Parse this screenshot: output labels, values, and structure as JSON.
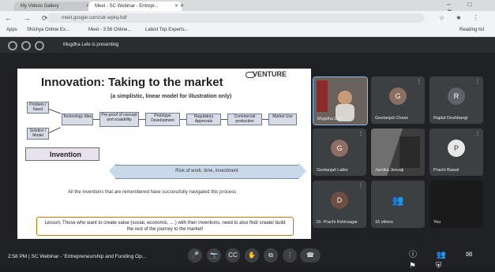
{
  "browser": {
    "tabs": [
      {
        "label": "My Videos Gallery"
      },
      {
        "label": "Meet - SC Webinar - Entrepr..."
      }
    ],
    "new_tab": "+",
    "window_controls": "– □ ✕",
    "nav": "← → ⟳",
    "url": "meet.google.com/sdr-wpkq-hdf",
    "tool_icons": "☆ ★ ⋮",
    "bookmarks": [
      {
        "label": "Apps"
      },
      {
        "label": "Shishya Online Ex..."
      },
      {
        "label": "Meet - 3:56 Online..."
      },
      {
        "label": "Latest Top Experts..."
      },
      {
        "label": "Reading list"
      }
    ]
  },
  "meet": {
    "presenting_text": "Mugdha Lele is presenting",
    "slide": {
      "title": "Innovation: Taking to the market",
      "brand": "VENTURE",
      "subtitle": "(a simplistic, linear model for illustration only)",
      "flow_left": [
        "Problem / Need",
        "Solution / Model"
      ],
      "flow_steps": [
        "Technology Idea",
        "Pre-proof of concept and scalability",
        "Prototype Development",
        "Regulatory Approvals",
        "Commercial production",
        "Market Use"
      ],
      "invention_label": "Invention",
      "arrow_label": "Risk of work, time, investment",
      "note": "All the inventions that are remembered have successfully navigated this process",
      "lesson": "Lesson: Those who want to create value (social, economic, ... ) with their inventions, need to also find/ create/ build the rest of the journey to the market!"
    },
    "participants": [
      {
        "name": "Mugdha Lele",
        "initial": ""
      },
      {
        "name": "Geetanjali Chase",
        "initial": "G"
      },
      {
        "name": "Rajdal Deshbangi",
        "initial": "R"
      },
      {
        "name": "Geetanjali Latke",
        "initial": "G"
      },
      {
        "name": "Jarnika Jeevaji",
        "initial": ""
      },
      {
        "name": "Prachi Bawal",
        "initial": "P"
      },
      {
        "name": "Dr. Prachi Kshirsagar",
        "initial": "D"
      },
      {
        "name": "16 others",
        "initial": "👥"
      },
      {
        "name": "You",
        "initial": ""
      }
    ],
    "meeting_info": "2:58 PM  |  SC Webinar - 'Entrepreneurship and Funding Op...",
    "controls": [
      "🎤",
      "📷",
      "CC",
      "✋",
      "⧉",
      "⋮",
      "☎"
    ],
    "right_controls": "ⓘ 👥 ✉ ⚑ ⛨"
  },
  "colors": {
    "meet_bg": "#202124",
    "tile_bg": "#3c4043",
    "lesson_border": "#c07a00",
    "risk_arrow": "#c9d9ea"
  }
}
